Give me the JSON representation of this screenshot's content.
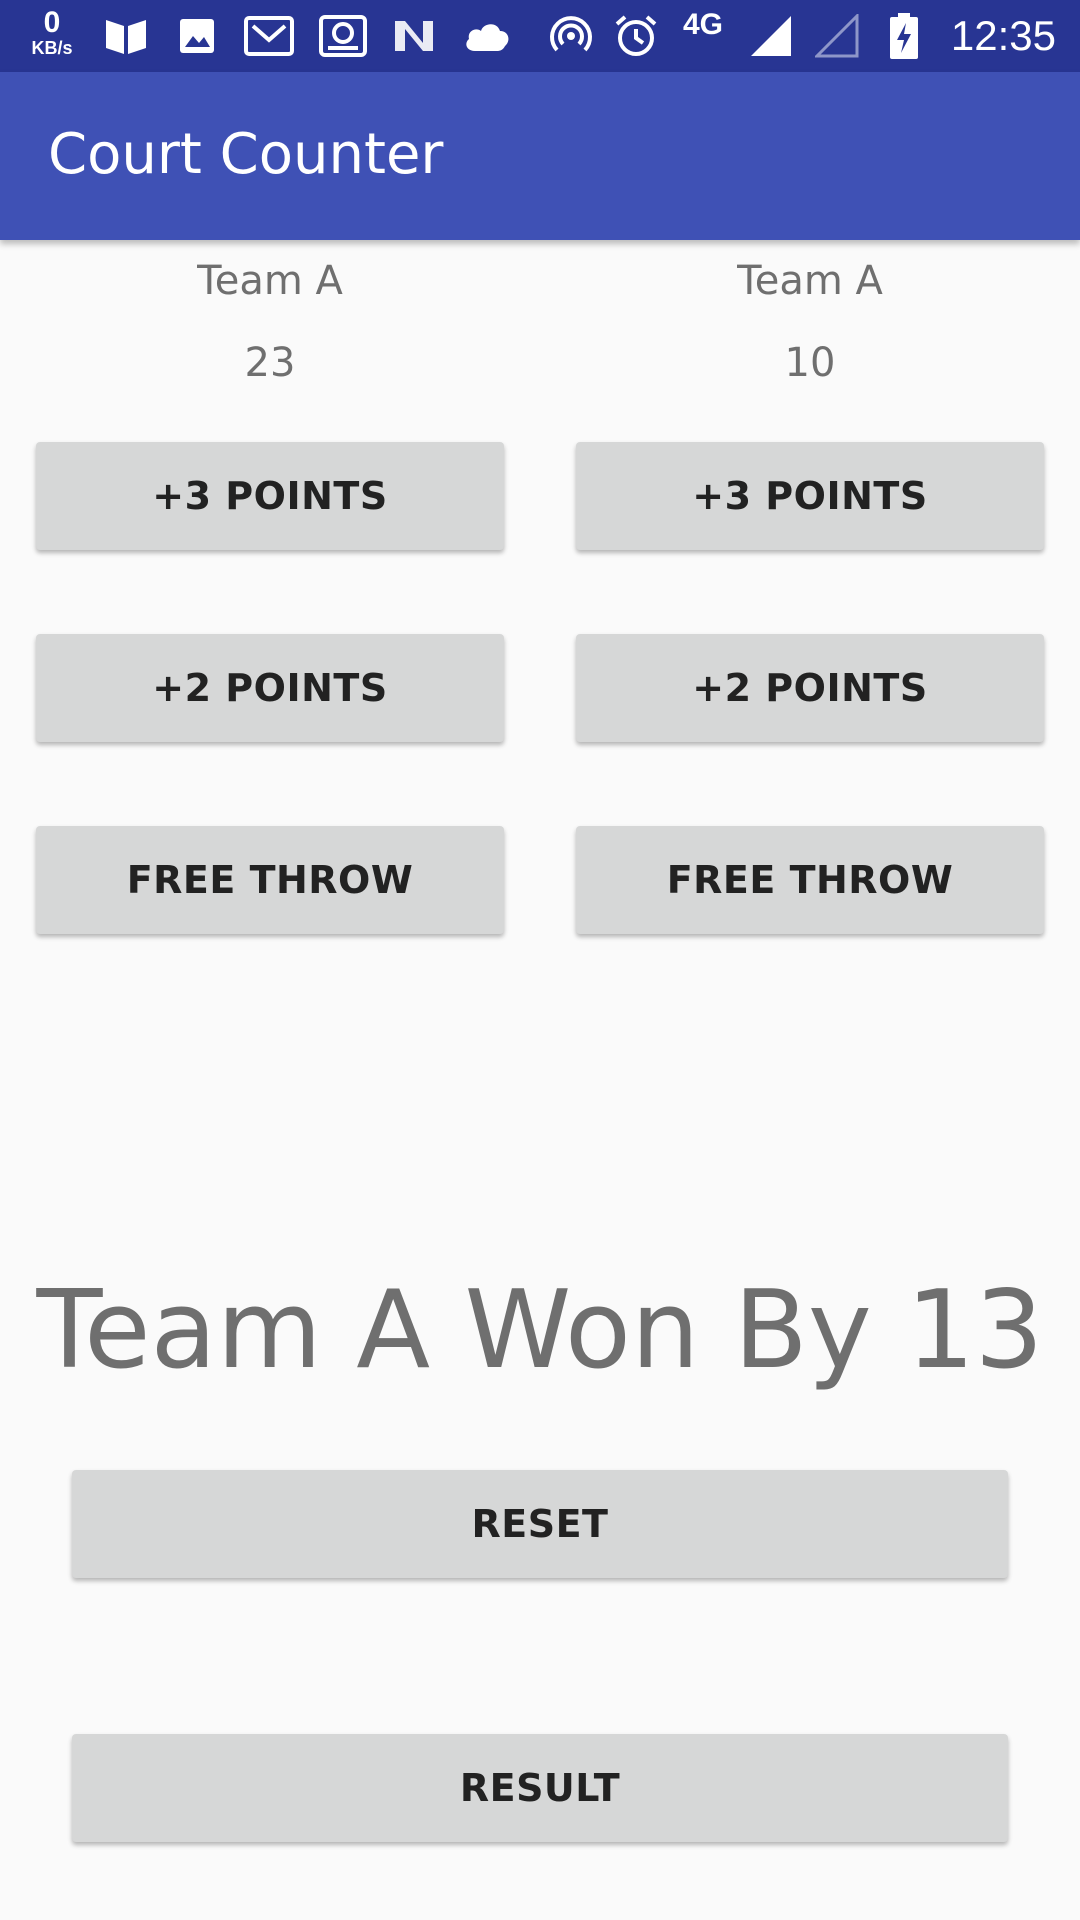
{
  "status_bar": {
    "net_speed_value": "0",
    "net_speed_unit": "KB/s",
    "network_type": "4G",
    "time": "12:35"
  },
  "app": {
    "title": "Court Counter"
  },
  "team_left": {
    "name": "Team A",
    "score": "23",
    "btn_three": "+3 POINTS",
    "btn_two": "+2 POINTS",
    "btn_free": "FREE THROW"
  },
  "team_right": {
    "name": "Team A",
    "score": "10",
    "btn_three": "+3 POINTS",
    "btn_two": "+2 POINTS",
    "btn_free": "FREE THROW"
  },
  "result_message": "Team A Won By 13",
  "actions": {
    "reset_label": "RESET",
    "result_label": "RESULT"
  },
  "colors": {
    "status_bar": "#283593",
    "app_bar": "#3f51b5",
    "button_bg": "#d6d7d7",
    "text_gray": "#6f6f6f"
  }
}
